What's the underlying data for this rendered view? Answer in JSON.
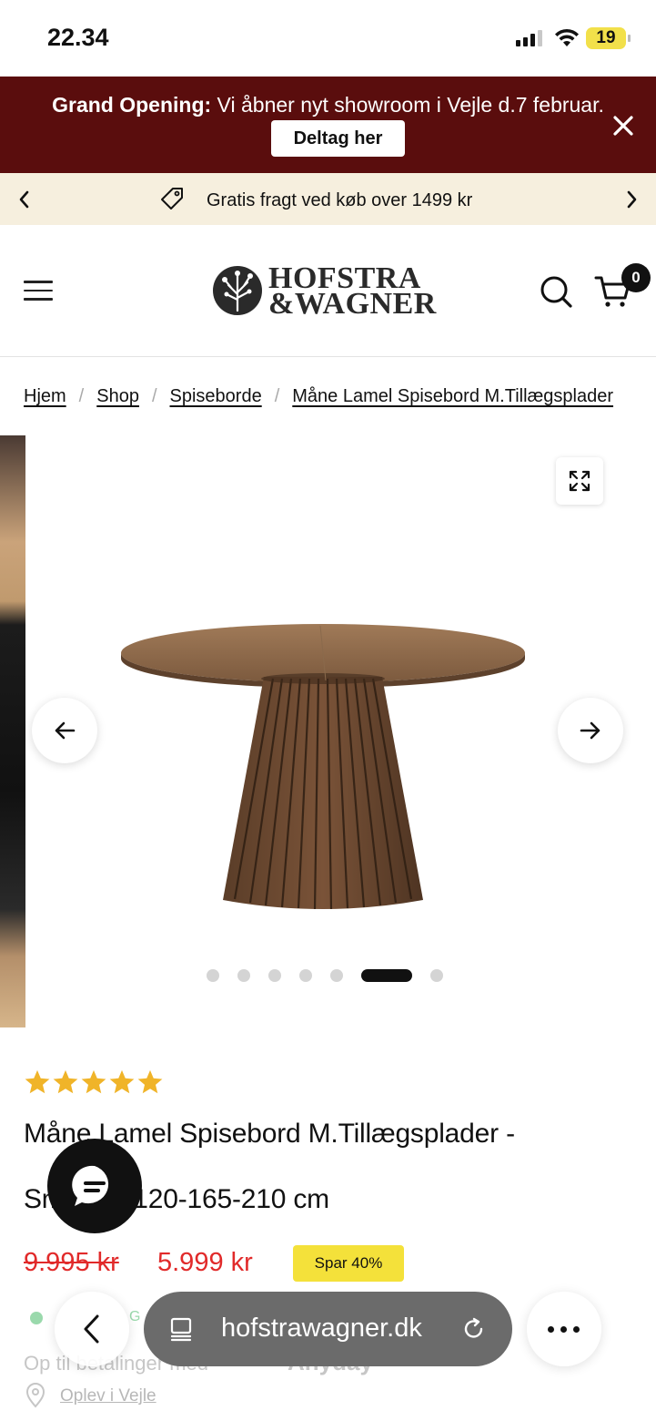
{
  "status_bar": {
    "time": "22.34",
    "battery": "19"
  },
  "announcement": {
    "bold": "Grand Opening:",
    "text": " Vi åbner nyt showroom i Vejle d.7 februar.",
    "button": "Deltag her"
  },
  "shipping_bar": {
    "text": "Gratis fragt ved køb over 1499 kr"
  },
  "header": {
    "logo_line1": "HOFSTRA",
    "logo_line2": "&WAGNER",
    "cart_count": "0"
  },
  "breadcrumb": [
    {
      "label": "Hjem"
    },
    {
      "label": "Shop"
    },
    {
      "label": "Spiseborde"
    },
    {
      "label": "Måne Lamel Spisebord M.Tillægsplader"
    }
  ],
  "gallery": {
    "slide_count": 7,
    "active_index": 5
  },
  "product": {
    "rating": 5,
    "title_line1": "Måne Lamel Spisebord M.Tillægsplader -",
    "title_line2": "Sm    Eg Ø120-165-210 cm",
    "price_old": "9.995 kr",
    "price_new": "5.999 kr",
    "discount_badge": "Spar 40%",
    "stock_text": "G",
    "payment_text": "Op til    betalinger med",
    "payment_brand": "Anyday",
    "location_link": "Oplev i Vejle"
  },
  "browser": {
    "url": "hofstrawagner.dk"
  },
  "colors": {
    "announcement_bg": "#5a0d0d",
    "shipping_bg": "#f6efde",
    "price_red": "#e12a2a",
    "badge_yellow": "#f4e13a",
    "star_gold": "#f0b429"
  }
}
